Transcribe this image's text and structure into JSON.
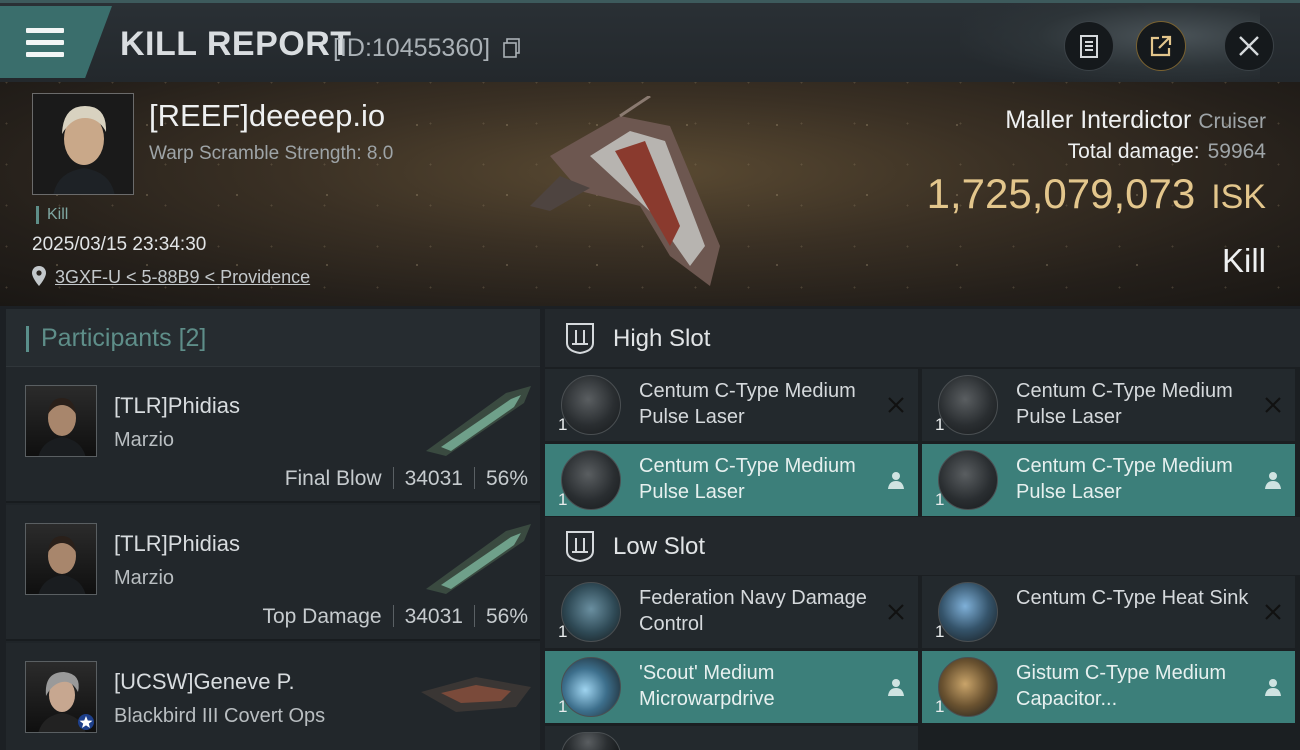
{
  "window": {
    "title": "KILL REPORT",
    "report_id": "[ID:10455360]"
  },
  "victim": {
    "name": "[REEF]deeeep.io",
    "subtitle": "Warp Scramble Strength: 8.0",
    "tag": "Kill",
    "datetime": "2025/03/15 23:34:30",
    "location": "3GXF-U < 5-88B9 < Providence"
  },
  "ship": {
    "name": "Maller Interdictor",
    "class": "Cruiser",
    "total_damage_label": "Total damage:",
    "total_damage": "59964",
    "isk_value": "1,725,079,073",
    "isk_unit": "ISK",
    "result": "Kill"
  },
  "participants": {
    "label": "Participants",
    "count": "[2]",
    "rows": [
      {
        "name": "[TLR]Phidias",
        "ship": "Marzio",
        "role": "Final Blow",
        "damage": "34031",
        "percent": "56%"
      },
      {
        "name": "[TLR]Phidias",
        "ship": "Marzio",
        "role": "Top Damage",
        "damage": "34031",
        "percent": "56%"
      },
      {
        "name": "[UCSW]Geneve P.",
        "ship": "Blackbird III Covert Ops",
        "role": "",
        "damage": "",
        "percent": ""
      }
    ]
  },
  "fitting": {
    "high_slot": {
      "title": "High Slot",
      "modules": [
        {
          "name": "Centum C-Type Medium Pulse Laser",
          "qty": "1",
          "status": "destroyed"
        },
        {
          "name": "Centum C-Type Medium Pulse Laser",
          "qty": "1",
          "status": "destroyed"
        },
        {
          "name": "Centum C-Type Medium Pulse Laser",
          "qty": "1",
          "status": "dropped"
        },
        {
          "name": "Centum C-Type Medium Pulse Laser",
          "qty": "1",
          "status": "dropped"
        }
      ]
    },
    "low_slot": {
      "title": "Low Slot",
      "modules": [
        {
          "name": "Federation Navy Damage Control",
          "qty": "1",
          "status": "destroyed"
        },
        {
          "name": "Centum C-Type Heat Sink",
          "qty": "1",
          "status": "destroyed"
        },
        {
          "name": "'Scout' Medium Microwarpdrive",
          "qty": "1",
          "status": "dropped"
        },
        {
          "name": "Gistum C-Type Medium Capacitor...",
          "qty": "1",
          "status": "dropped"
        }
      ]
    }
  },
  "colors": {
    "accent_teal": "#3c7f7a",
    "isk_gold": "#e3c68c",
    "menu_tab": "#3a6e6c"
  },
  "icons": [
    "menu-icon",
    "copy-icon",
    "clipboard-icon",
    "share-icon",
    "close-icon",
    "location-pin-icon",
    "slot-icon",
    "destroyed-x-icon",
    "dropped-person-icon"
  ]
}
